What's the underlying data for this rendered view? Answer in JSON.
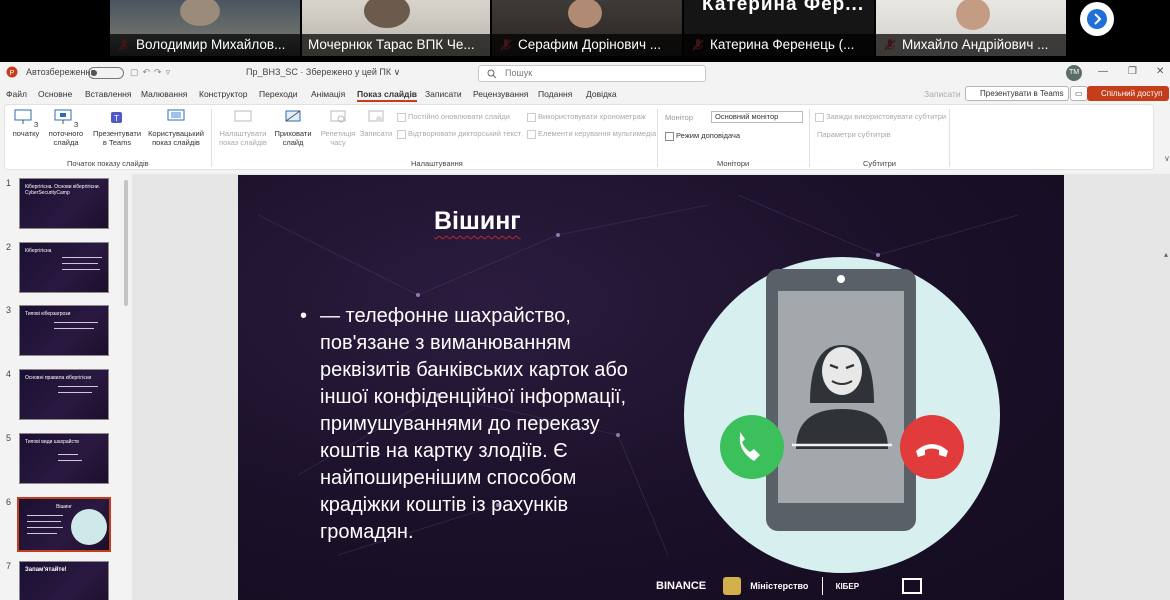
{
  "participants": [
    {
      "name": "Володимир Михайлов..."
    },
    {
      "name": "Мочернюк Тарас ВПК Че..."
    },
    {
      "name": "Серафим Дорінович ..."
    },
    {
      "name": "Катерина  Ференець (..."
    },
    {
      "name": "Михайло Андрійович ..."
    }
  ],
  "overlay_name": "Катерина   Фер...",
  "titlebar": {
    "autosave": "Автозбереження",
    "filename": "Пр_ВНЗ_SC · Збережено у цей ПК ∨",
    "search_placeholder": "Пошук",
    "avatar": "ТМ"
  },
  "menu": [
    "Файл",
    "Основне",
    "Вставлення",
    "Малювання",
    "Конструктор",
    "Переходи",
    "Анімація",
    "Показ слайдів",
    "Записати",
    "Рецензування",
    "Подання",
    "Довідка"
  ],
  "menu_right": {
    "record": "Записати",
    "present_teams": "Презентувати в Teams",
    "share": "Спільний доступ"
  },
  "ribbon": {
    "from_start": "З початку",
    "from_current": "З поточного слайда",
    "present_teams": "Презентувати в Teams",
    "custom_show": "Користувацький показ слайдів",
    "group_start": "Початок показу слайдів",
    "setup_show": "Налаштувати показ слайдів",
    "hide_slide": "Приховати слайд",
    "rehearse": "Репетиція часу",
    "record": "Записати",
    "keep_updated": "Постійно оновлювати слайди",
    "play_narration": "Відтворювати дикторський текст",
    "use_timings": "Використовувати хронометраж",
    "media_controls": "Елементи керування мультимедіа",
    "group_setup": "Налаштування",
    "monitor_label": "Монітор",
    "monitor_value": "Основний монітор",
    "presenter_view": "Режим доповідача",
    "group_monitors": "Монітори",
    "always_subtitles": "Завжди використовувати субтитри",
    "subtitle_settings": "Параметри субтитрів",
    "group_subtitles": "Субтитри"
  },
  "thumbnails": [
    {
      "num": "1",
      "title": "Кібергігієна. Основи кібергігієни. CyberSecurityCamp"
    },
    {
      "num": "2",
      "title": "Кібергігієна"
    },
    {
      "num": "3",
      "title": "Типові кіберзагрози"
    },
    {
      "num": "4",
      "title": "Основні правила кібергігієни"
    },
    {
      "num": "5",
      "title": "Типові види шахрайств"
    },
    {
      "num": "6",
      "title": "Вішинг"
    },
    {
      "num": "7",
      "title": "Запам'ятайте!"
    }
  ],
  "slide": {
    "title": "Вішинг",
    "body": "— телефонне шахрайство, пов'язане з виманюванням реквізитів банківських карток або іншої конфіденційної інформації, примушуваннями до переказу коштів на картку злодіїв. Є найпоширенішим способом крадіжки коштів із рахунків громадян.",
    "logos": [
      "BINANCE",
      "Міністерство",
      "КІБЕР"
    ]
  }
}
